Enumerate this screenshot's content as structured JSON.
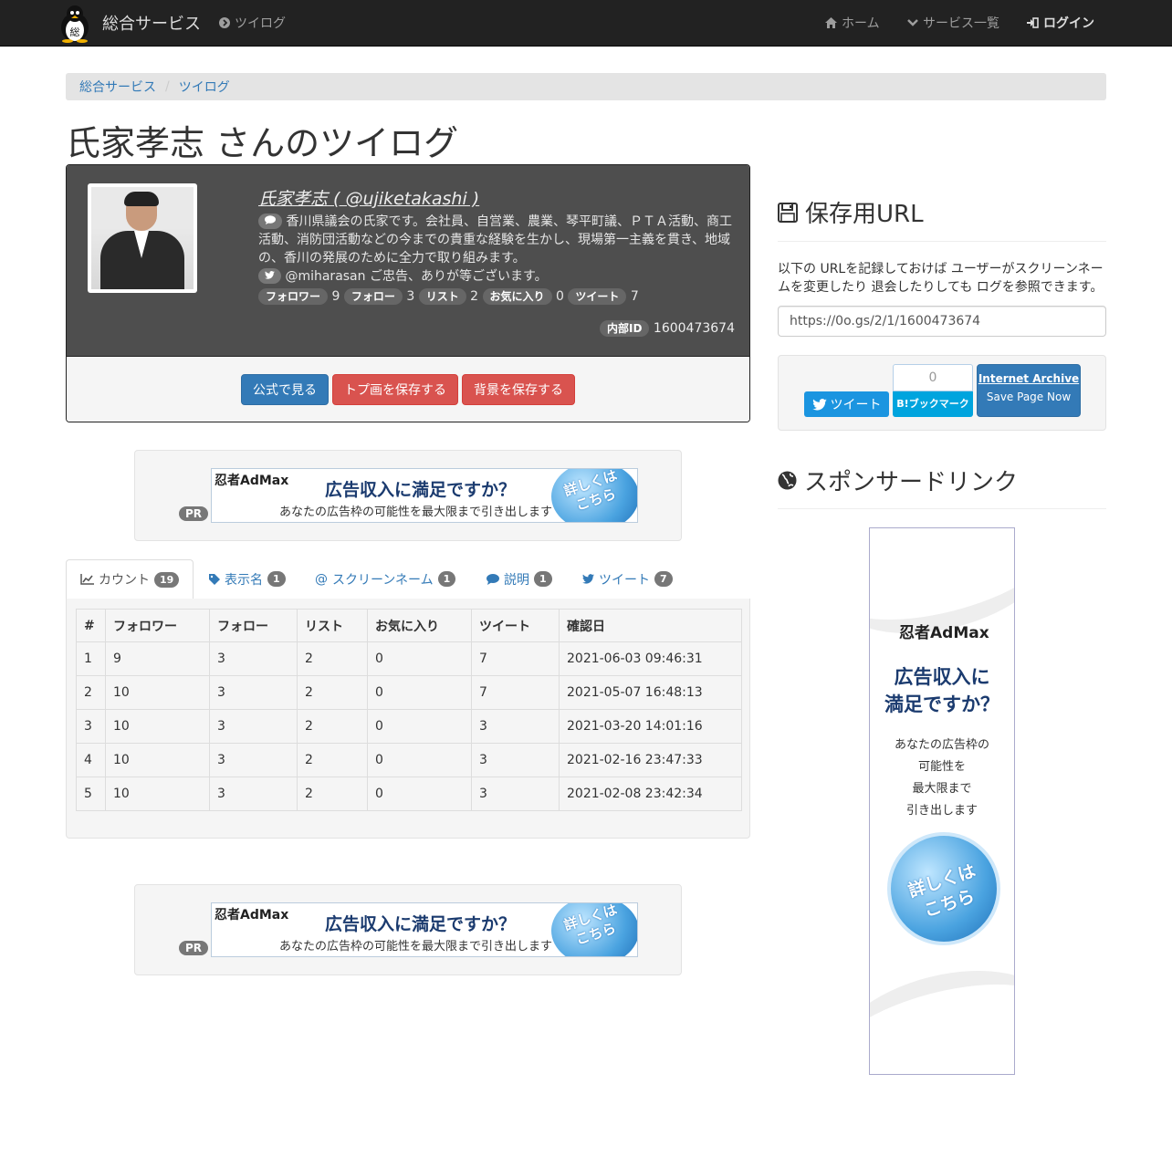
{
  "navbar": {
    "brand": "総合サービス",
    "service_link": "ツイログ",
    "home": "ホーム",
    "services": "サービス一覧",
    "login": "ログイン"
  },
  "breadcrumb": {
    "root": "総合サービス",
    "current": "ツイログ"
  },
  "page_title": "氏家孝志 さんのツイログ",
  "profile": {
    "name_link": "氏家孝志 ( @ujiketakashi )",
    "bio": "香川県議会の氏家です。会社員、自営業、農業、琴平町議、ＰＴＡ活動、商工活動、消防団活動などの今までの貴重な経験を生かし、現場第一主義を貫き、地域の、香川の発展のために全力で取り組みます。",
    "last_tweet": "@miharasan ご忠告、ありが等ございます。",
    "stats": [
      {
        "label": "フォロワー",
        "value": "9"
      },
      {
        "label": "フォロー",
        "value": "3"
      },
      {
        "label": "リスト",
        "value": "2"
      },
      {
        "label": "お気に入り",
        "value": "0"
      },
      {
        "label": "ツイート",
        "value": "7"
      }
    ],
    "internal_id_label": "内部ID",
    "internal_id": "1600473674",
    "buttons": {
      "official": "公式で見る",
      "save_icon": "トプ画を保存する",
      "save_bg": "背景を保存する"
    }
  },
  "ad_banner": {
    "pr": "PR",
    "logo": "忍者AdMax",
    "headline": "広告収入に満足ですか？",
    "sub": "あなたの広告枠の可能性を最大限まで引き出します",
    "ball": "詳しくは\nこちら"
  },
  "tabs": [
    {
      "label": "カウント",
      "count": "19"
    },
    {
      "label": "表示名",
      "count": "1"
    },
    {
      "label": "スクリーンネーム",
      "count": "1"
    },
    {
      "label": "説明",
      "count": "1"
    },
    {
      "label": "ツイート",
      "count": "7"
    }
  ],
  "table": {
    "headers": [
      "#",
      "フォロワー",
      "フォロー",
      "リスト",
      "お気に入り",
      "ツイート",
      "確認日"
    ],
    "rows": [
      [
        "1",
        "9",
        "3",
        "2",
        "0",
        "7",
        "2021-06-03 09:46:31"
      ],
      [
        "2",
        "10",
        "3",
        "2",
        "0",
        "7",
        "2021-05-07 16:48:13"
      ],
      [
        "3",
        "10",
        "3",
        "2",
        "0",
        "3",
        "2021-03-20 14:01:16"
      ],
      [
        "4",
        "10",
        "3",
        "2",
        "0",
        "3",
        "2021-02-16 23:47:33"
      ],
      [
        "5",
        "10",
        "3",
        "2",
        "0",
        "3",
        "2021-02-08 23:42:34"
      ]
    ]
  },
  "sidebar": {
    "save_url_heading": "保存用URL",
    "save_url_desc": "以下の URLを記録しておけば ユーザーがスクリーンネームを変更したり 退会したりしても ログを参照できます。",
    "save_url_value": "https://0o.gs/2/1/1600473674",
    "tweet_button": "ツイート",
    "hatena_count": "0",
    "hatena_button": "B!ブックマーク",
    "ia_title": "Internet Archive",
    "ia_sub": "Save Page Now",
    "sponsor_heading": "スポンサードリンク",
    "sky_logo": "忍者AdMax",
    "sky_headline": "広告収入に\n満足ですか？",
    "sky_text": "あなたの広告枠の\n可能性を\n最大限まで\n引き出します",
    "sky_ball": "詳しくは\nこちら"
  },
  "colors": {
    "navbar_bg": "#222222",
    "link": "#337ab7",
    "primary": "#337ab7",
    "danger": "#d9534f",
    "twitter": "#1b95e0",
    "hatena": "#00a4de"
  }
}
